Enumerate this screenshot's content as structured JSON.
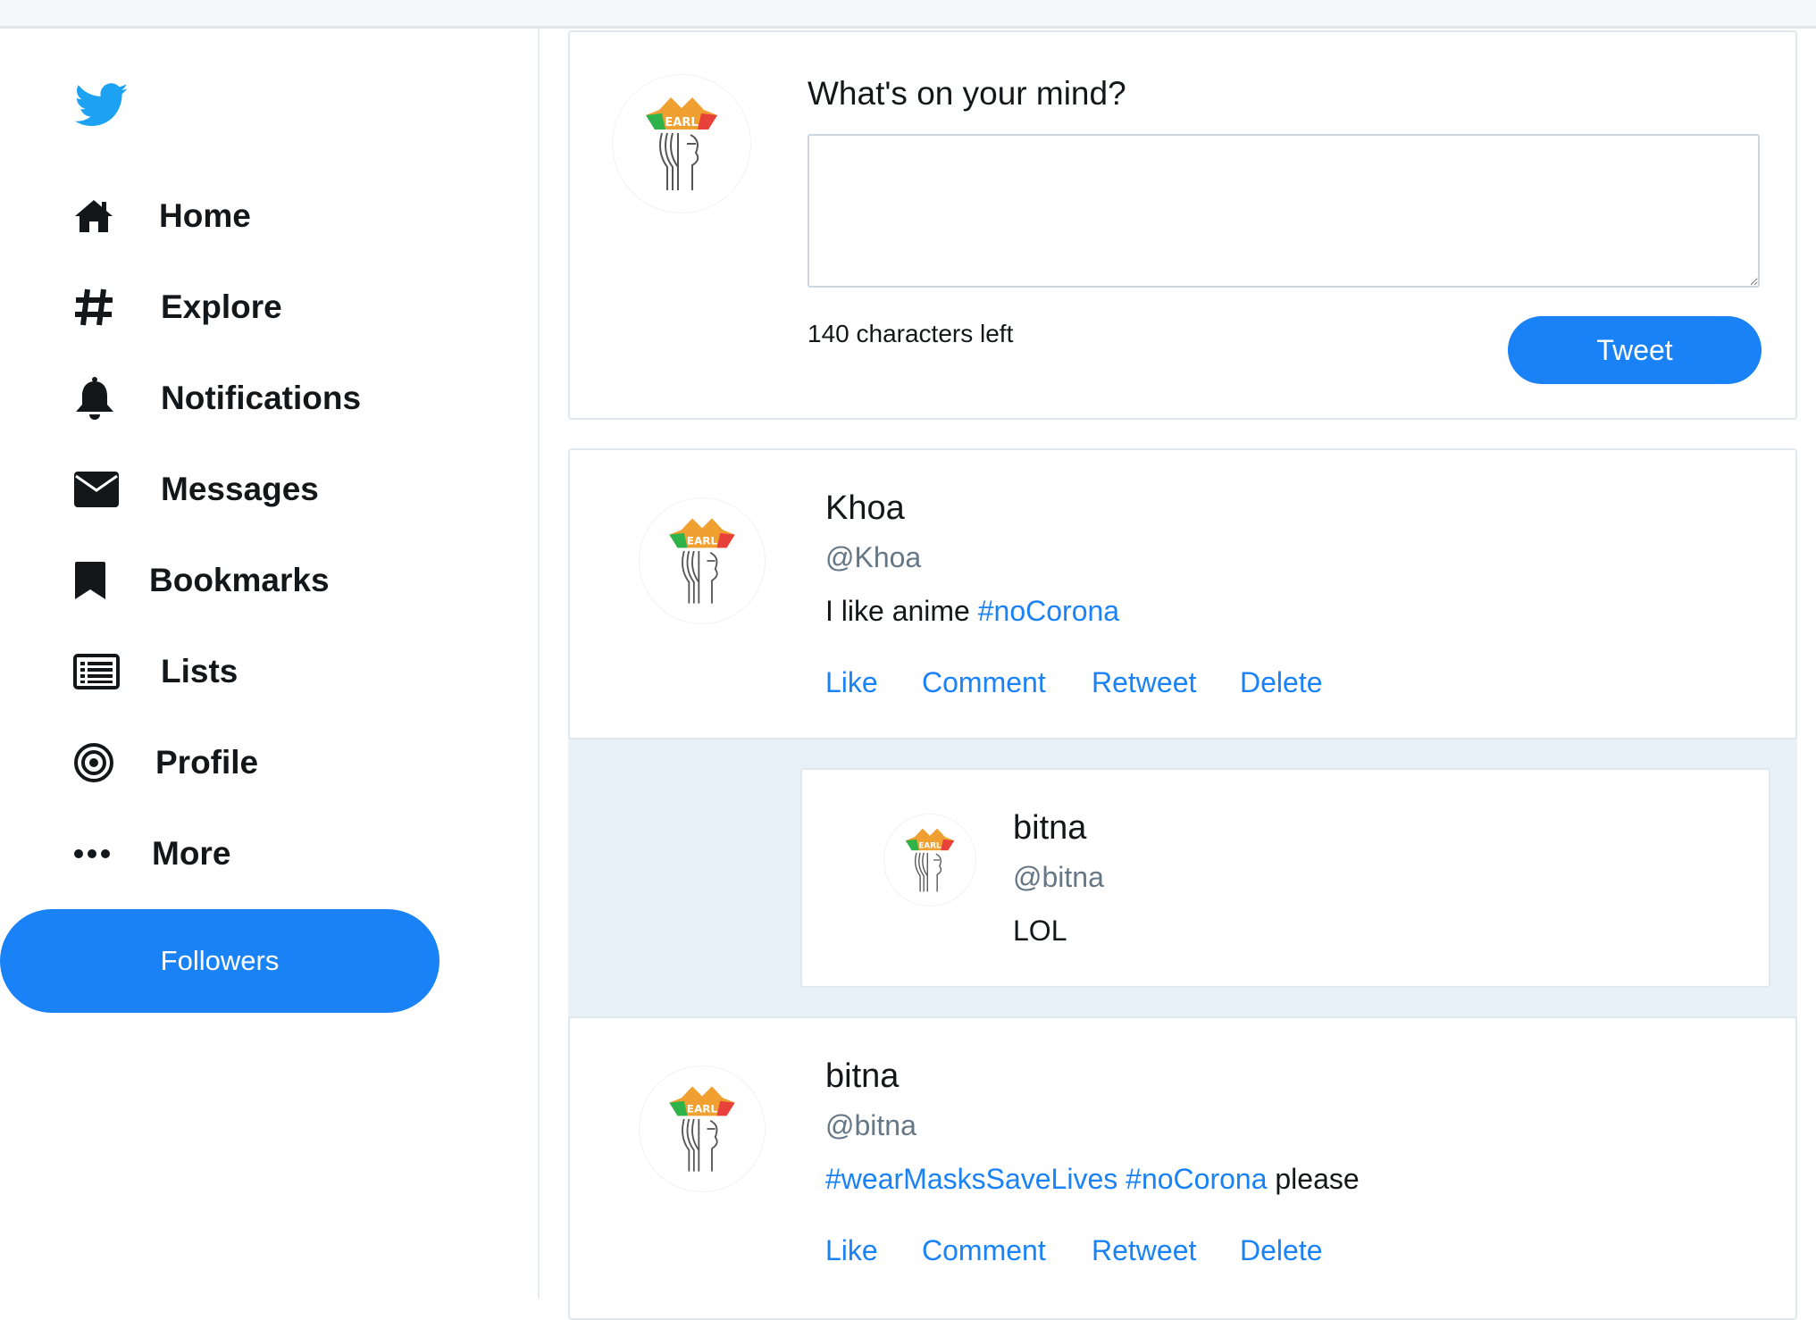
{
  "colors": {
    "accent": "#1a82f7",
    "twitter_blue": "#1da1f2",
    "text": "#14171a",
    "muted": "#657786",
    "border": "#e1e8ed",
    "reply_bg": "#e8f0f8"
  },
  "sidebar": {
    "logo_icon": "twitter-bird-icon",
    "items": [
      {
        "label": "Home",
        "icon": "home-icon"
      },
      {
        "label": "Explore",
        "icon": "hashtag-icon"
      },
      {
        "label": "Notifications",
        "icon": "bell-icon"
      },
      {
        "label": "Messages",
        "icon": "envelope-icon"
      },
      {
        "label": "Bookmarks",
        "icon": "bookmark-icon"
      },
      {
        "label": "Lists",
        "icon": "list-icon"
      },
      {
        "label": "Profile",
        "icon": "target-icon"
      },
      {
        "label": "More",
        "icon": "ellipsis-icon"
      }
    ],
    "followers_button": "Followers"
  },
  "compose": {
    "prompt": "What's on your mind?",
    "textarea_value": "",
    "chars_left": "140 characters left",
    "tweet_button": "Tweet"
  },
  "actions": {
    "like": "Like",
    "comment": "Comment",
    "retweet": "Retweet",
    "delete": "Delete"
  },
  "tweets": [
    {
      "name": "Khoa",
      "handle": "@Khoa",
      "text_plain": "I like anime ",
      "hashtags": [
        "#noCorona"
      ],
      "text_after": "",
      "reply": {
        "name": "bitna",
        "handle": "@bitna",
        "text": "LOL"
      }
    },
    {
      "name": "bitna",
      "handle": "@bitna",
      "text_plain": "",
      "hashtags": [
        "#wearMasksSaveLives",
        "#noCorona"
      ],
      "text_after": "please"
    }
  ],
  "avatar_logo_text": "EARL"
}
